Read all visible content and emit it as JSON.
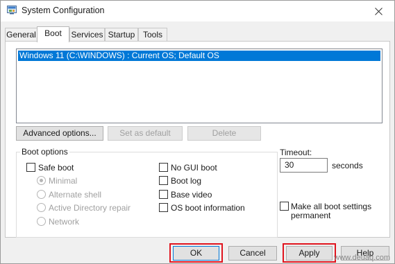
{
  "window": {
    "title": "System Configuration",
    "icon": "msconfig-icon"
  },
  "tabs": [
    {
      "label": "General",
      "active": false
    },
    {
      "label": "Boot",
      "active": true
    },
    {
      "label": "Services",
      "active": false
    },
    {
      "label": "Startup",
      "active": false
    },
    {
      "label": "Tools",
      "active": false
    }
  ],
  "os_list": {
    "items": [
      {
        "label": "Windows 11 (C:\\WINDOWS) : Current OS; Default OS",
        "selected": true
      }
    ]
  },
  "list_buttons": {
    "advanced": "Advanced options...",
    "set_default": "Set as default",
    "delete": "Delete"
  },
  "boot_options": {
    "legend": "Boot options",
    "safe_boot": {
      "label": "Safe boot",
      "checked": false
    },
    "minimal": {
      "label": "Minimal",
      "checked": true,
      "enabled": false
    },
    "alternate_shell": {
      "label": "Alternate shell",
      "checked": false,
      "enabled": false
    },
    "active_directory_repair": {
      "label": "Active Directory repair",
      "checked": false,
      "enabled": false
    },
    "network": {
      "label": "Network",
      "checked": false,
      "enabled": false
    },
    "no_gui_boot": {
      "label": "No GUI boot",
      "checked": false
    },
    "boot_log": {
      "label": "Boot log",
      "checked": false
    },
    "base_video": {
      "label": "Base video",
      "checked": false
    },
    "os_boot_information": {
      "label": "OS boot information",
      "checked": false
    }
  },
  "timeout": {
    "label": "Timeout:",
    "value": "30",
    "unit": "seconds"
  },
  "make_permanent": {
    "label_line1": "Make all boot settings",
    "label_line2": "permanent",
    "checked": false
  },
  "footer_buttons": {
    "ok": "OK",
    "cancel": "Cancel",
    "apply": "Apply",
    "help": "Help"
  },
  "watermark": "www.deuaq.com",
  "colors": {
    "selection": "#0078d7",
    "highlight": "#e0141e",
    "disabled_text": "#a0a0a0"
  }
}
